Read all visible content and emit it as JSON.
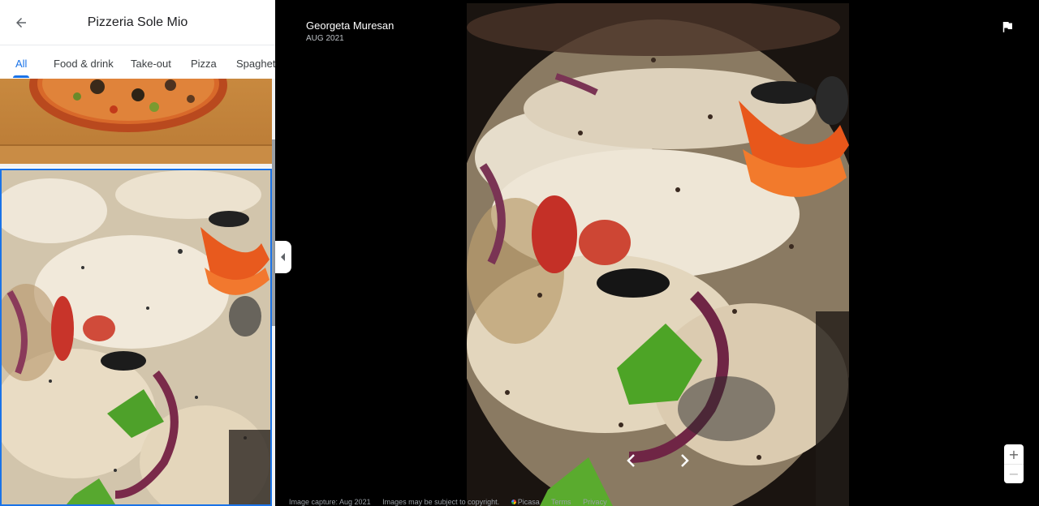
{
  "header": {
    "title": "Pizzeria Sole Mio"
  },
  "tabs": [
    {
      "label": "All",
      "active": true
    },
    {
      "label": "Food & drink",
      "active": false
    },
    {
      "label": "Take-out",
      "active": false
    },
    {
      "label": "Pizza",
      "active": false
    },
    {
      "label": "Spaghetti",
      "active": false
    }
  ],
  "viewer": {
    "author": "Georgeta Muresan",
    "date": "AUG 2021"
  },
  "footer": {
    "capture": "Image capture: Aug 2021",
    "copyright": "Images may be subject to copyright.",
    "brand": "Picasa",
    "terms": "Terms",
    "privacy": "Privacy"
  },
  "zoom": {
    "in": "+",
    "out": "−"
  },
  "colors": {
    "accent": "#1a73e8",
    "viewer_bg": "#000000"
  },
  "icons": [
    "arrow-back-icon",
    "flag-icon",
    "chevron-left-icon",
    "chevron-right-icon",
    "collapse-arrow-icon"
  ]
}
